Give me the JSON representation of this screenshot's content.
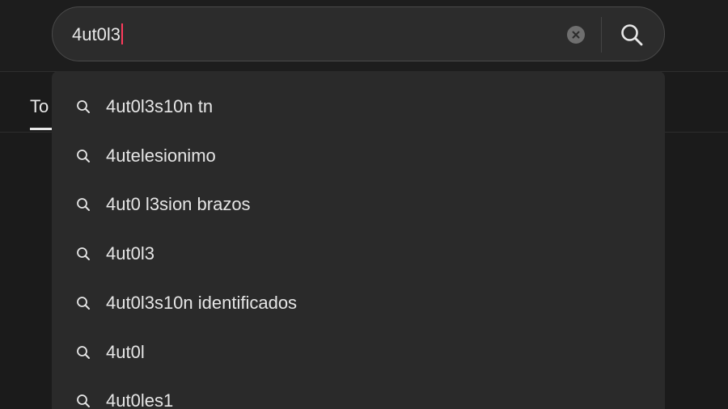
{
  "search": {
    "value": "4ut0l3",
    "clear_label": "Clear",
    "submit_label": "Search"
  },
  "tabs": {
    "active_peek": "To"
  },
  "suggestions": [
    "4ut0l3s10n tn",
    "4utelesionimo",
    "4ut0 l3sion brazos",
    "4ut0l3",
    "4ut0l3s10n identificados",
    "4ut0l",
    "4ut0les1"
  ],
  "colors": {
    "background": "#1b1b1b",
    "search_bar": "#2c2c2c",
    "dropdown": "#2a2a2a",
    "caret": "#ff3b5c",
    "text": "#e8e8e8"
  }
}
